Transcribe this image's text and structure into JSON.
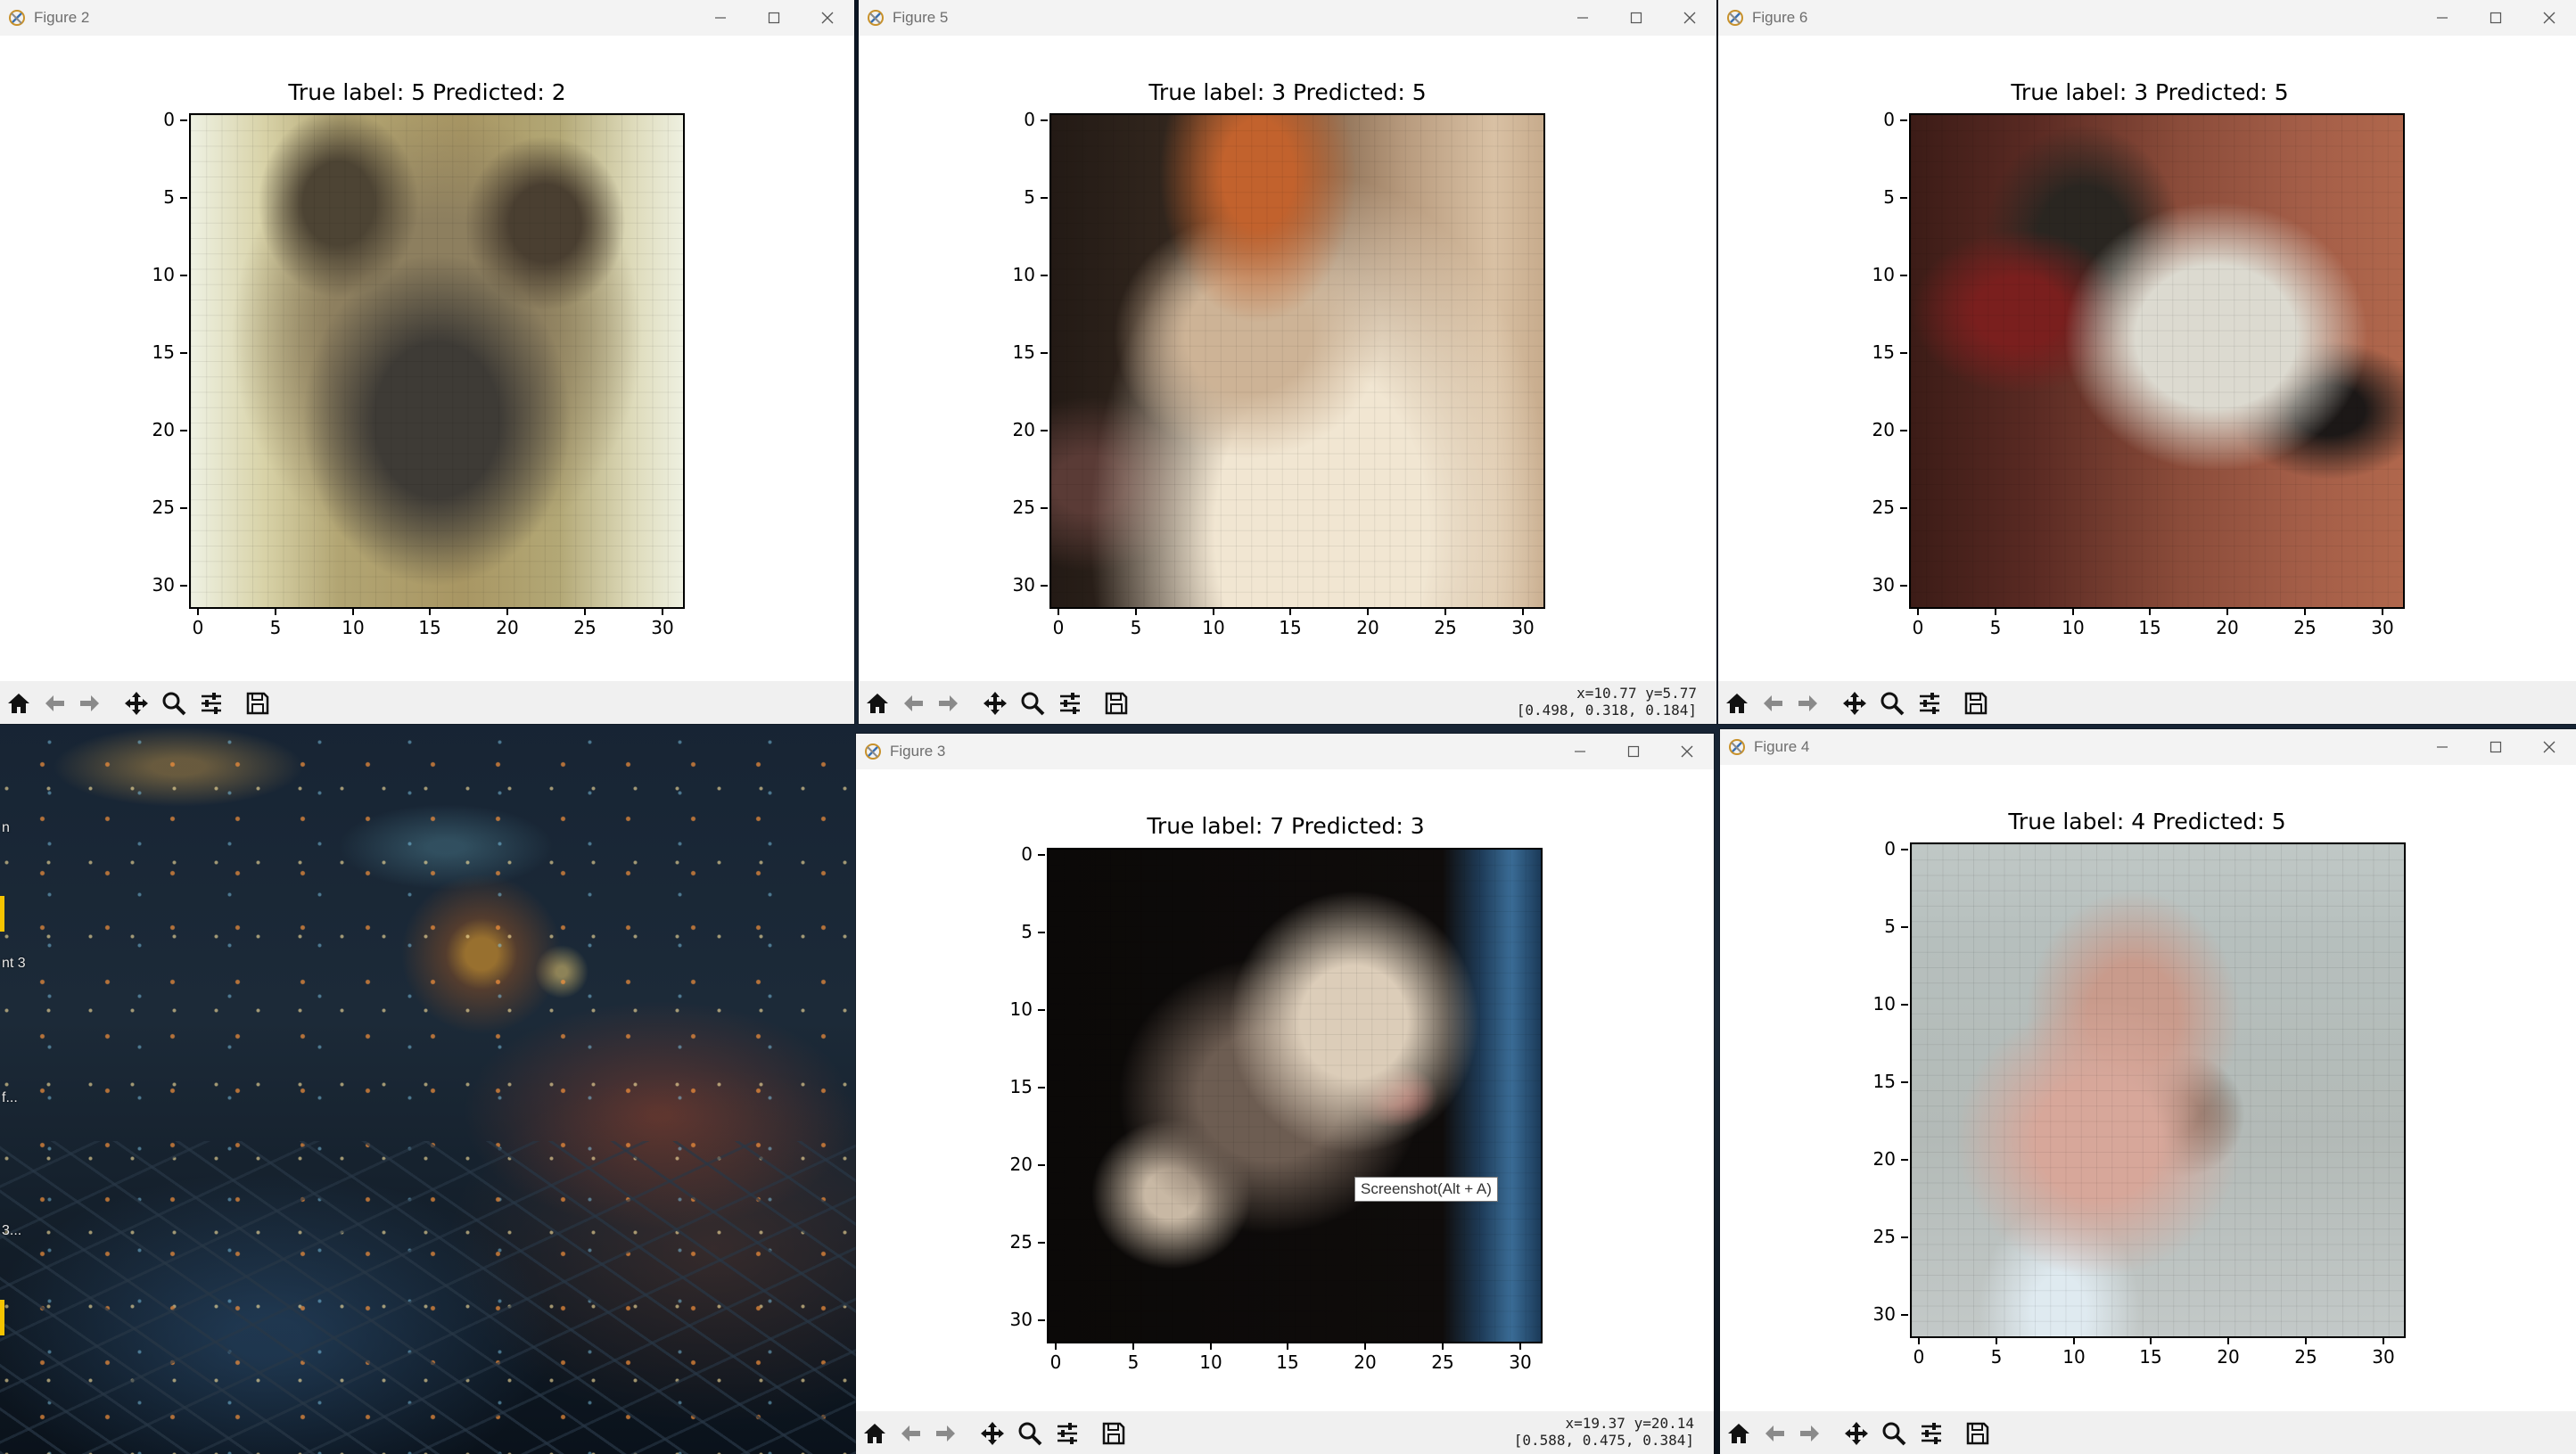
{
  "colors": {
    "titlebar_bg": "#f3f3f3",
    "toolbar_bg": "#f0f0f0",
    "window_bg": "#ffffff"
  },
  "desktop": {
    "side_labels": [
      "n",
      "nt 3",
      "f...",
      "3..."
    ]
  },
  "figures": [
    {
      "window_title": "Figure 2",
      "plot_title": "True label: 5 Predicted: 2",
      "image_palette": [
        "#c8b77a",
        "#6e6150",
        "#4a4036",
        "#e9e6d2"
      ],
      "coordinates": null
    },
    {
      "window_title": "Figure 5",
      "plot_title": "True label: 3 Predicted: 5",
      "image_palette": [
        "#2e231c",
        "#b46a3a",
        "#c9b49a",
        "#efe3d0"
      ],
      "coordinates": {
        "line1": "x=10.77  y=5.77",
        "line2": "[0.498, 0.318, 0.184]"
      }
    },
    {
      "window_title": "Figure 6",
      "plot_title": "True label: 3 Predicted: 5",
      "image_palette": [
        "#8c3f35",
        "#2a1c18",
        "#cfcdc4",
        "#a35a42"
      ],
      "coordinates": null
    },
    {
      "window_title": "Figure 3",
      "plot_title": "True label: 7 Predicted: 3",
      "image_palette": [
        "#0d0b0a",
        "#6f6258",
        "#d5c6b4",
        "#2f5f8a"
      ],
      "coordinates": {
        "line1": "x=19.37  y=20.14",
        "line2": "[0.588, 0.475, 0.384]"
      },
      "tooltip": "Screenshot(Alt + A)"
    },
    {
      "window_title": "Figure 4",
      "plot_title": "True label: 4 Predicted: 5",
      "image_palette": [
        "#b9c3c4",
        "#d6a79a",
        "#7b6b5b",
        "#dfe6e6"
      ],
      "coordinates": null
    }
  ],
  "axis": {
    "y_ticks": [
      "0",
      "5",
      "10",
      "15",
      "20",
      "25",
      "30"
    ],
    "x_ticks": [
      "0",
      "5",
      "10",
      "15",
      "20",
      "25",
      "30"
    ]
  },
  "toolbar_icons": [
    "home-icon",
    "back-icon",
    "forward-icon",
    "pan-icon",
    "zoom-icon",
    "configure-subplots-icon",
    "save-icon"
  ]
}
